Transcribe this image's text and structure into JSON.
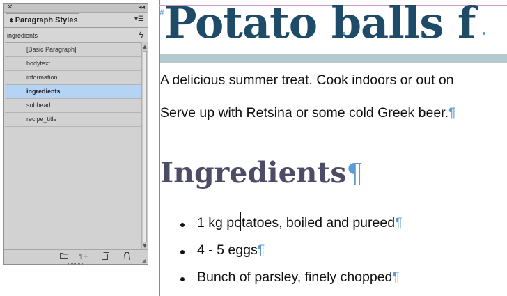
{
  "panel": {
    "title": "Paragraph Styles",
    "current_style": "ingredients",
    "icons": {
      "close": "close-icon",
      "collapse": "collapse-icon",
      "menu": "panel-menu-icon",
      "quick_apply": "lightning-icon",
      "new_group": "folder-icon",
      "clear_overrides": "clear-overrides-icon",
      "new_style": "new-style-icon",
      "delete": "trash-icon"
    },
    "styles": [
      {
        "label": "[Basic Paragraph]",
        "selected": false
      },
      {
        "label": "bodytext",
        "selected": false
      },
      {
        "label": "information",
        "selected": false
      },
      {
        "label": "ingredients",
        "selected": true
      },
      {
        "label": "subhead",
        "selected": false
      },
      {
        "label": "recipe_title",
        "selected": false
      }
    ],
    "colors": {
      "selection": "#b5d3f5",
      "panel_bg": "#d6d6d6"
    }
  },
  "document": {
    "title": "Potato balls f",
    "intro_line1": "A delicious summer treat. Cook indoors or out on",
    "intro_line2": "Serve up with Retsina or some cold Greek beer.",
    "subhead": "Ingredients",
    "pilcrow": "¶",
    "ingredients": [
      "1 kg potatoes, boiled and pureed",
      "4 - 5 eggs",
      "Bunch of parsley, finely chopped"
    ],
    "colors": {
      "title": "#1d4b68",
      "title_rule": "#b6c9d1",
      "subhead": "#4c4c66",
      "hidden_chars": "#5e9ad3"
    }
  }
}
